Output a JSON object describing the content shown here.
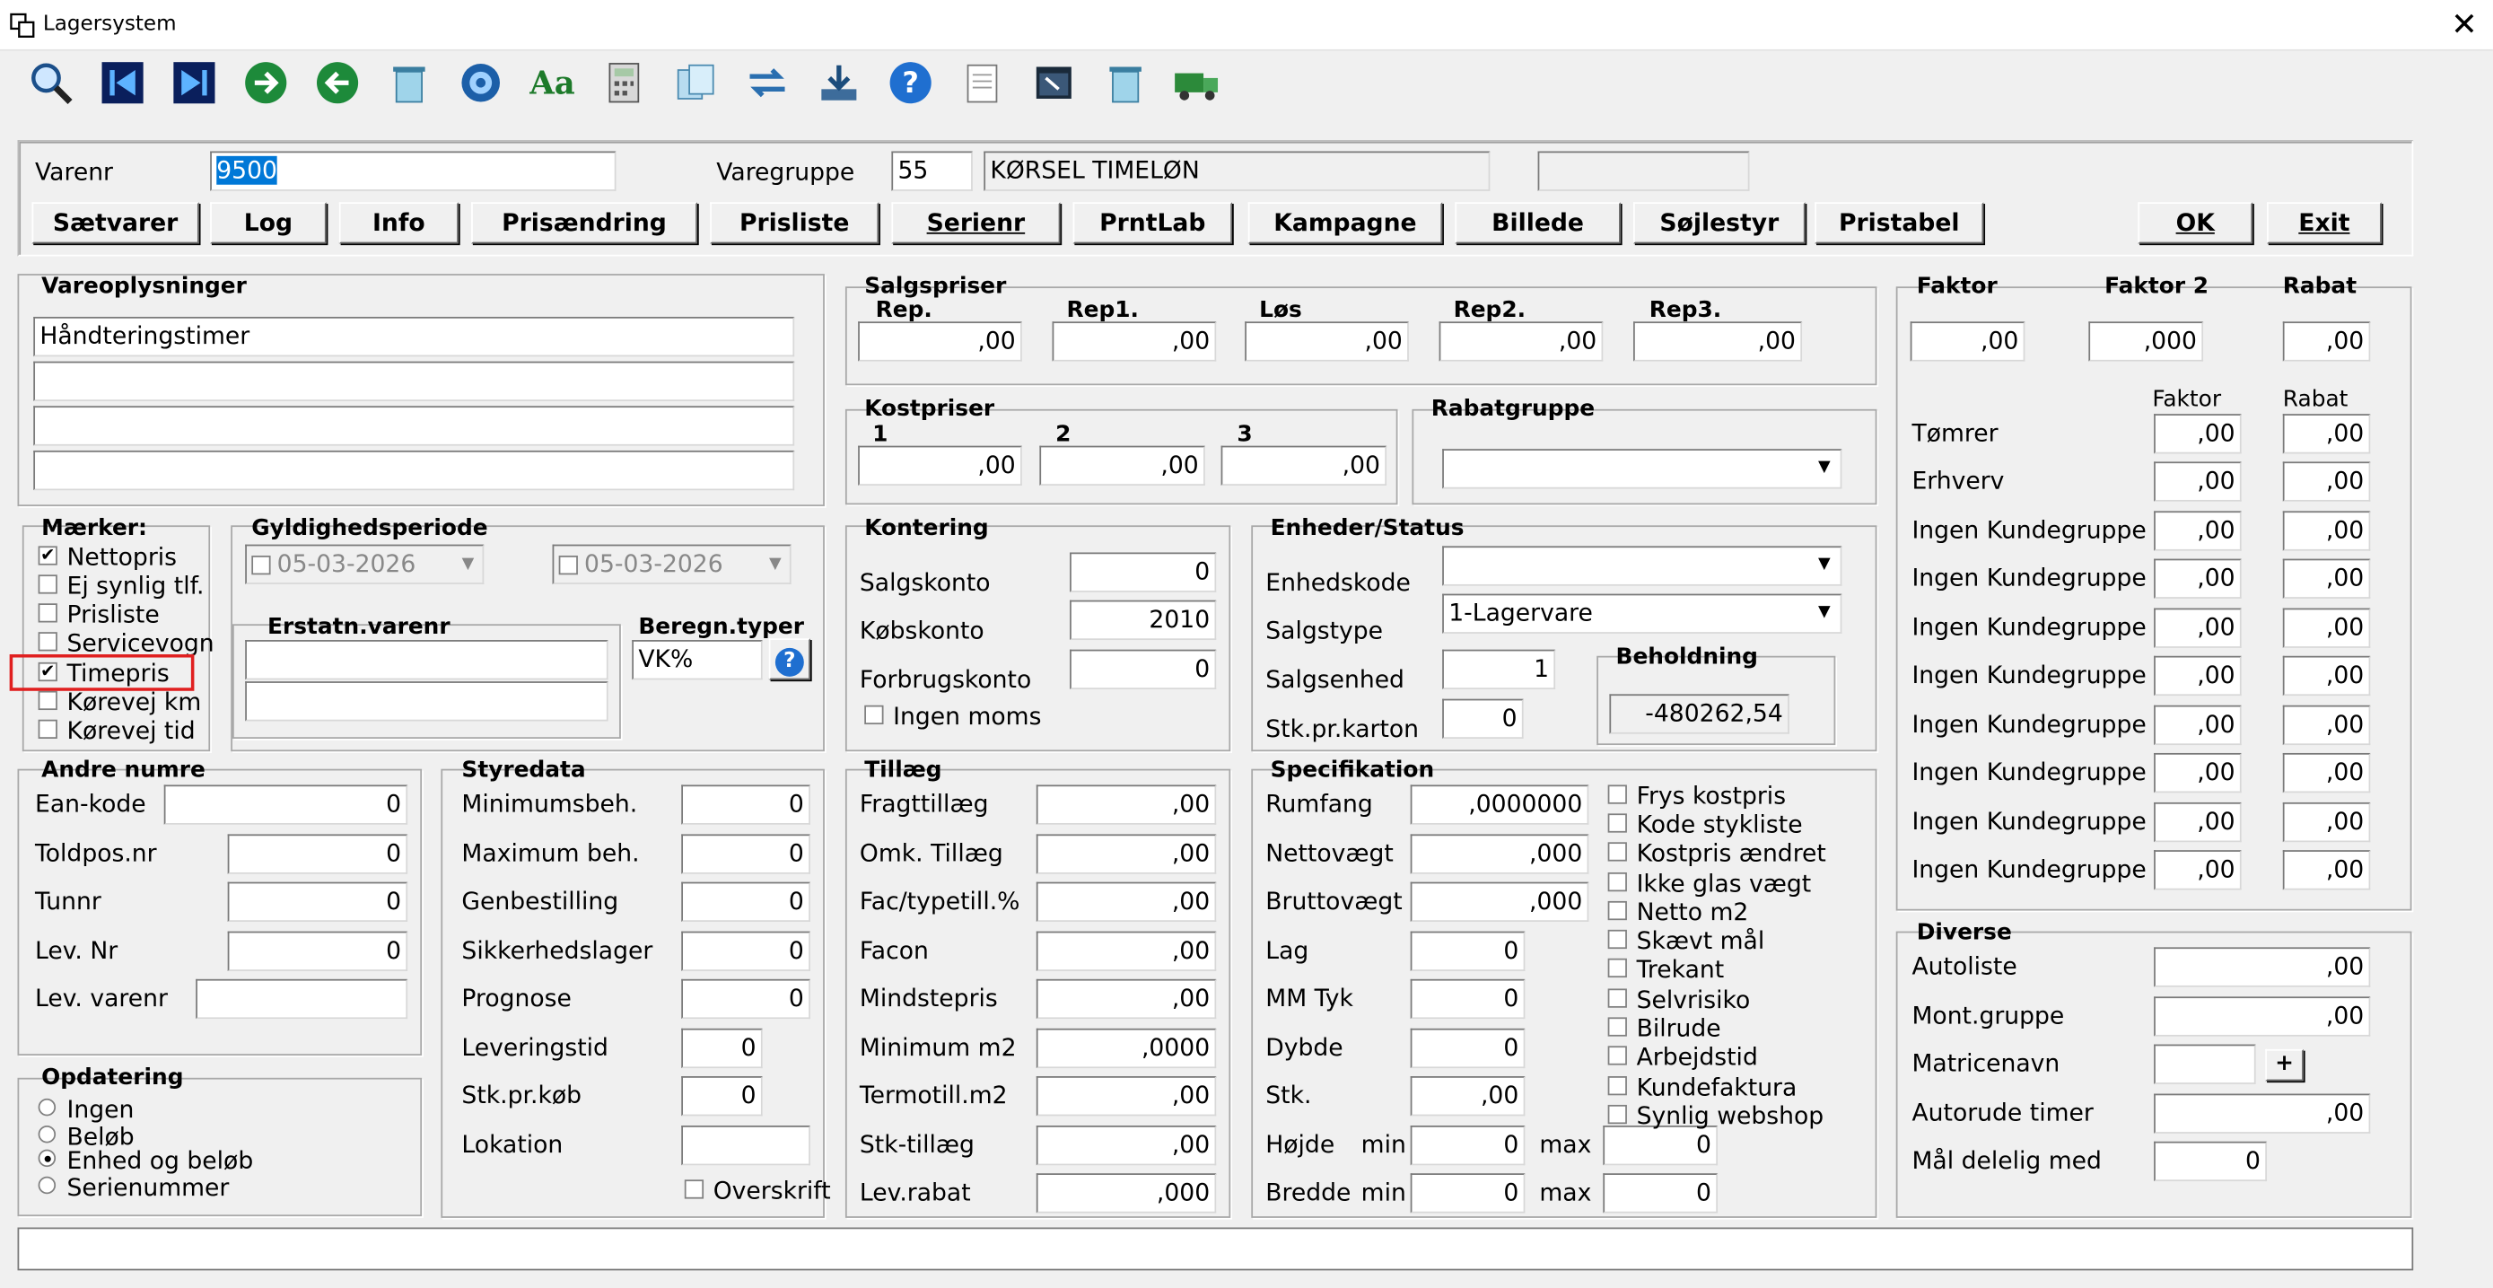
{
  "window": {
    "title": "Lagersystem",
    "close": "✕"
  },
  "toolbar": {
    "icons": [
      "search-icon",
      "first-record-icon",
      "last-record-icon",
      "next-icon",
      "previous-icon",
      "delete-icon",
      "target-icon",
      "font-icon",
      "calculator-icon",
      "copy-icon",
      "transfer-icon",
      "download-icon",
      "help-icon",
      "notes-icon",
      "window-icon",
      "recycle-icon",
      "truck-icon"
    ]
  },
  "header": {
    "varenr_label": "Varenr",
    "varenr_value": "9500",
    "varegruppe_label": "Varegruppe",
    "varegruppe_value": "55",
    "varegruppe_name": "KØRSEL TIMELØN",
    "extra_value": ""
  },
  "buttons": {
    "saetvarer": "Sætvarer",
    "log": "Log",
    "info": "Info",
    "prisaendring": "Prisændring",
    "prisliste": "Prisliste",
    "serienr": "Serienr",
    "prntlab": "PrntLab",
    "kampagne": "Kampagne",
    "billede": "Billede",
    "sojlestyr": "Søjlestyr",
    "pristabel": "Pristabel",
    "ok": "OK",
    "exit": "Exit"
  },
  "vareoplysninger": {
    "title": "Vareoplysninger",
    "lines": [
      "Håndteringstimer",
      "",
      "",
      ""
    ]
  },
  "maerker": {
    "title": "Mærker:",
    "items": [
      {
        "label": "Nettopris",
        "checked": "✔"
      },
      {
        "label": "Ej synlig tlf.",
        "checked": ""
      },
      {
        "label": "Prisliste",
        "checked": ""
      },
      {
        "label": "Servicevogn",
        "checked": ""
      },
      {
        "label": "Timepris",
        "checked": "✔"
      },
      {
        "label": "Kørevej km",
        "checked": ""
      },
      {
        "label": "Kørevej tid",
        "checked": ""
      }
    ]
  },
  "gyldighed": {
    "title": "Gyldighedsperiode",
    "from": "05-03-2026",
    "to": "05-03-2026",
    "erstatn_title": "Erstatn.varenr",
    "beregn_title": "Beregn.typer",
    "beregn_value": "VK%",
    "help": "?"
  },
  "salgspriser": {
    "title": "Salgspriser",
    "cols": [
      {
        "label": "Rep.",
        "value": ",00"
      },
      {
        "label": "Rep1.",
        "value": ",00"
      },
      {
        "label": "Løs",
        "value": ",00"
      },
      {
        "label": "Rep2.",
        "value": ",00"
      },
      {
        "label": "Rep3.",
        "value": ",00"
      }
    ]
  },
  "kostpriser": {
    "title": "Kostpriser",
    "cols": [
      {
        "label": "1",
        "value": ",00"
      },
      {
        "label": "2",
        "value": ",00"
      },
      {
        "label": "3",
        "value": ",00"
      }
    ]
  },
  "rabatgruppe": {
    "title": "Rabatgruppe",
    "value": ""
  },
  "kontering": {
    "title": "Kontering",
    "salgskonto_label": "Salgskonto",
    "salgskonto": "0",
    "kobskonto_label": "Købskonto",
    "kobskonto": "2010",
    "forbrug_label": "Forbrugskonto",
    "forbrug": "0",
    "ingen_moms": "Ingen moms"
  },
  "enheder": {
    "title": "Enheder/Status",
    "enhedskode_label": "Enhedskode",
    "enhedskode": "",
    "salgstype_label": "Salgstype",
    "salgstype": "1-Lagervare",
    "salgsenhed_label": "Salgsenhed",
    "salgsenhed": "1",
    "stk_label": "Stk.pr.karton",
    "stk": "0",
    "beholdning_title": "Beholdning",
    "beholdning": "-480262,54"
  },
  "faktor": {
    "faktor_label": "Faktor",
    "faktor2_label": "Faktor 2",
    "rabat_label": "Rabat",
    "faktor": ",00",
    "faktor2": ",000",
    "rabat": ",00",
    "sub_faktor": "Faktor",
    "sub_rabat": "Rabat",
    "rows": [
      {
        "label": "Tømrer",
        "f": ",00",
        "r": ",00"
      },
      {
        "label": "Erhverv",
        "f": ",00",
        "r": ",00"
      },
      {
        "label": "Ingen Kundegruppe",
        "f": ",00",
        "r": ",00"
      },
      {
        "label": "Ingen Kundegruppe",
        "f": ",00",
        "r": ",00"
      },
      {
        "label": "Ingen Kundegruppe",
        "f": ",00",
        "r": ",00"
      },
      {
        "label": "Ingen Kundegruppe",
        "f": ",00",
        "r": ",00"
      },
      {
        "label": "Ingen Kundegruppe",
        "f": ",00",
        "r": ",00"
      },
      {
        "label": "Ingen Kundegruppe",
        "f": ",00",
        "r": ",00"
      },
      {
        "label": "Ingen Kundegruppe",
        "f": ",00",
        "r": ",00"
      },
      {
        "label": "Ingen Kundegruppe",
        "f": ",00",
        "r": ",00"
      }
    ]
  },
  "andre": {
    "title": "Andre numre",
    "rows": [
      {
        "label": "Ean-kode",
        "value": "0"
      },
      {
        "label": "Toldpos.nr",
        "value": "0"
      },
      {
        "label": "Tunnr",
        "value": "0"
      },
      {
        "label": "Lev. Nr",
        "value": "0"
      },
      {
        "label": "Lev. varenr",
        "value": ""
      }
    ]
  },
  "opdatering": {
    "title": "Opdatering",
    "options": [
      "Ingen",
      "Beløb",
      "Enhed og beløb",
      "Serienummer"
    ],
    "selected": "Enhed og beløb"
  },
  "styredata": {
    "title": "Styredata",
    "rows": [
      {
        "label": "Minimumsbeh.",
        "value": "0"
      },
      {
        "label": "Maximum beh.",
        "value": "0"
      },
      {
        "label": "Genbestilling",
        "value": "0"
      },
      {
        "label": "Sikkerhedslager",
        "value": "0"
      },
      {
        "label": "Prognose",
        "value": "0"
      },
      {
        "label": "Leveringstid",
        "value": "0"
      },
      {
        "label": "Stk.pr.køb",
        "value": "0"
      },
      {
        "label": "Lokation",
        "value": ""
      }
    ],
    "overskrift": "Overskrift"
  },
  "tillaeg": {
    "title": "Tillæg",
    "rows": [
      {
        "label": "Fragttillæg",
        "value": ",00"
      },
      {
        "label": "Omk. Tillæg",
        "value": ",00"
      },
      {
        "label": "Fac/typetill.%",
        "value": ",00"
      },
      {
        "label": "Facon",
        "value": ",00"
      },
      {
        "label": "Mindstepris",
        "value": ",00"
      },
      {
        "label": "Minimum m2",
        "value": ",0000"
      },
      {
        "label": "Termotill.m2",
        "value": ",00"
      },
      {
        "label": "Stk-tillæg",
        "value": ",00"
      },
      {
        "label": "Lev.rabat",
        "value": ",000"
      }
    ]
  },
  "specifikation": {
    "title": "Specifikation",
    "rows": [
      {
        "label": "Rumfang",
        "value": ",0000000"
      },
      {
        "label": "Nettovægt",
        "value": ",000"
      },
      {
        "label": "Bruttovægt",
        "value": ",000"
      },
      {
        "label": "Lag",
        "value": "0"
      },
      {
        "label": "MM Tyk",
        "value": "0"
      },
      {
        "label": "Dybde",
        "value": "0"
      },
      {
        "label": "Stk.",
        "value": ",00"
      }
    ],
    "hojde_label": "Højde",
    "bredde_label": "Bredde",
    "min": "min",
    "max": "max",
    "hojde_min": "0",
    "hojde_max": "0",
    "bredde_min": "0",
    "bredde_max": "0",
    "checks": [
      "Frys kostpris",
      "Kode stykliste",
      "Kostpris ændret",
      "Ikke glas vægt",
      "Netto m2",
      "Skævt mål",
      "Trekant",
      "Selvrisiko",
      "Bilrude",
      "Arbejdstid",
      "Kundefaktura",
      "Synlig webshop"
    ]
  },
  "diverse": {
    "title": "Diverse",
    "autoliste_label": "Autoliste",
    "autoliste": ",00",
    "mont_label": "Mont.gruppe",
    "mont": ",00",
    "matrice_label": "Matricenavn",
    "matrice": "",
    "plus": "+",
    "autorude_label": "Autorude timer",
    "autorude": ",00",
    "maal_label": "Mål delelig med",
    "maal": "0"
  },
  "status": {
    "text": ""
  }
}
